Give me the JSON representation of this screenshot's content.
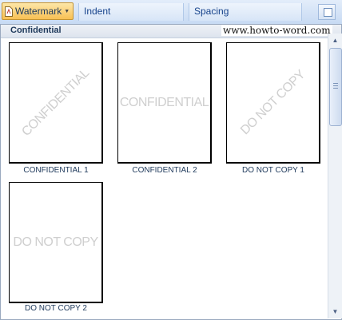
{
  "ribbon": {
    "watermark_button": "Watermark",
    "groups": [
      "Indent",
      "Spacing"
    ]
  },
  "gallery": {
    "category": "Confidential",
    "site_url": "www.howto-word.com",
    "items": [
      {
        "label": "CONFIDENTIAL 1",
        "watermark": "CONFIDENTIAL",
        "orientation": "diagonal"
      },
      {
        "label": "CONFIDENTIAL 2",
        "watermark": "CONFIDENTIAL",
        "orientation": "horizontal"
      },
      {
        "label": "DO NOT COPY 1",
        "watermark": "DO NOT COPY",
        "orientation": "diagonal"
      },
      {
        "label": "DO NOT COPY 2",
        "watermark": "DO NOT COPY",
        "orientation": "horizontal"
      }
    ]
  },
  "icons": {
    "watermark_button": "page-watermark-icon",
    "dropdown": "caret-down-icon",
    "launcher": "dialog-launcher-icon",
    "scroll_up": "scroll-up-arrow-icon",
    "scroll_down": "scroll-down-arrow-icon"
  },
  "colors": {
    "ribbon_text": "#15428b",
    "button_highlight": "#f8c054",
    "caption_text": "#1e395b",
    "watermark_gray": "#cfcfcf"
  }
}
